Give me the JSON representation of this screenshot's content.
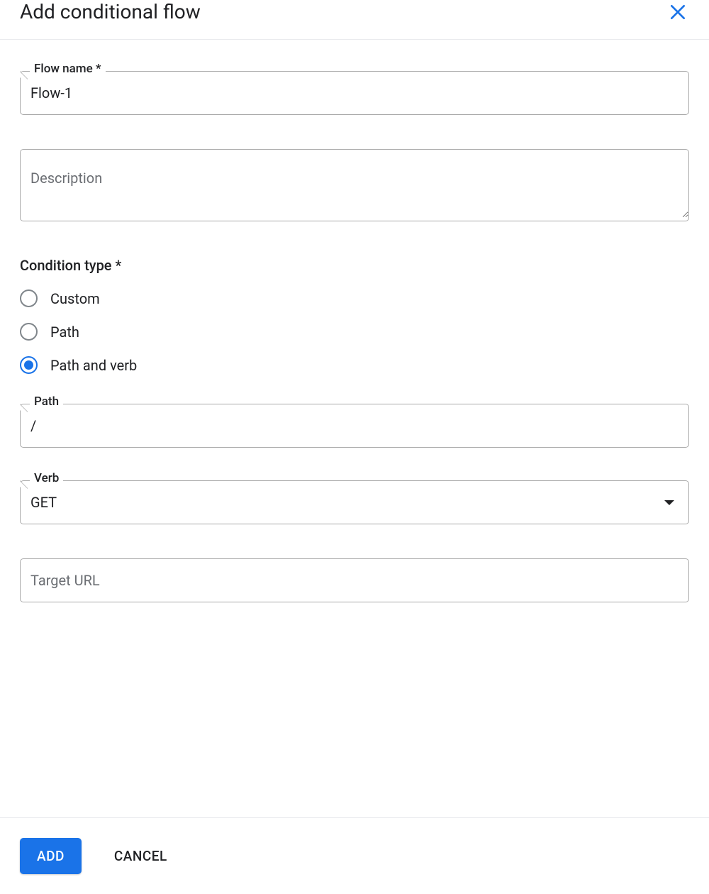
{
  "dialog": {
    "title": "Add conditional flow"
  },
  "fields": {
    "flow_name": {
      "label": "Flow name *",
      "value": "Flow-1"
    },
    "description": {
      "placeholder": "Description",
      "value": ""
    },
    "path": {
      "label": "Path",
      "value": "/"
    },
    "verb": {
      "label": "Verb",
      "value": "GET"
    },
    "target_url": {
      "placeholder": "Target URL",
      "value": ""
    }
  },
  "condition_type": {
    "label": "Condition type *",
    "options": [
      {
        "label": "Custom",
        "selected": false
      },
      {
        "label": "Path",
        "selected": false
      },
      {
        "label": "Path and verb",
        "selected": true
      }
    ]
  },
  "actions": {
    "add": "ADD",
    "cancel": "CANCEL"
  }
}
